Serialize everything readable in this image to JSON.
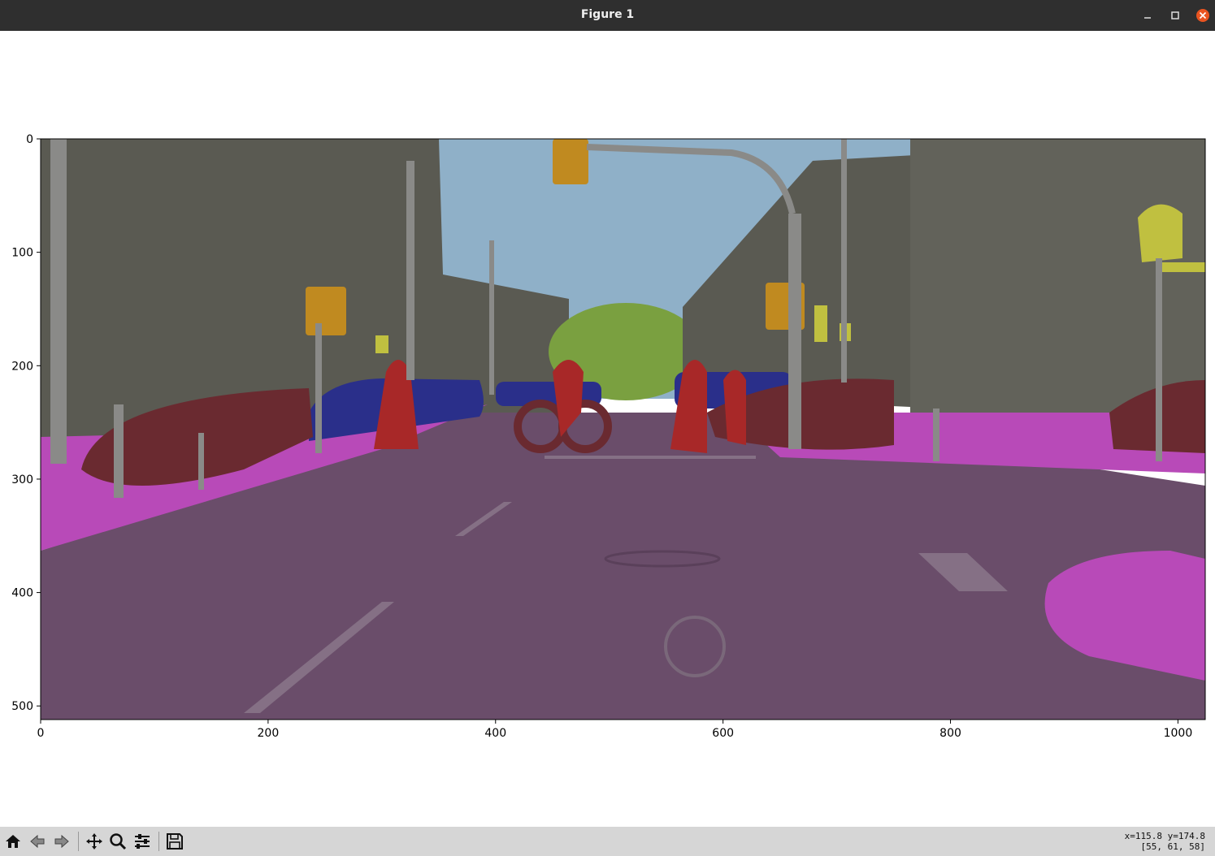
{
  "window": {
    "title": "Figure 1",
    "minimize_icon": "minimize-icon",
    "maximize_icon": "maximize-icon",
    "close_icon": "close-icon"
  },
  "plot": {
    "xlim": [
      0,
      1024
    ],
    "ylim": [
      512,
      0
    ],
    "xticks": [
      "0",
      "200",
      "400",
      "600",
      "800",
      "1000"
    ],
    "yticks": [
      "0",
      "100",
      "200",
      "300",
      "400",
      "500"
    ],
    "image": "segmentation overlay",
    "colors": {
      "road": "#6a4d6a",
      "sidewalk": "#b84ab8",
      "building": "#5a5a52",
      "sky": "#8fb0c8",
      "vegetation": "#7aa040",
      "car": "#2a2f8a",
      "person": "#a82828",
      "bicycle": "#6a2a30",
      "traffic_light": "#c08a20",
      "traffic_sign": "#c0c040",
      "pole": "#8a8a88"
    }
  },
  "toolbar": {
    "tools": [
      "home-icon",
      "back-icon",
      "forward-icon",
      "pan-icon",
      "zoom-icon",
      "configure-icon",
      "save-icon"
    ]
  },
  "status": {
    "coords": "x=115.8 y=174.8",
    "pixel": "[55, 61, 58]"
  }
}
